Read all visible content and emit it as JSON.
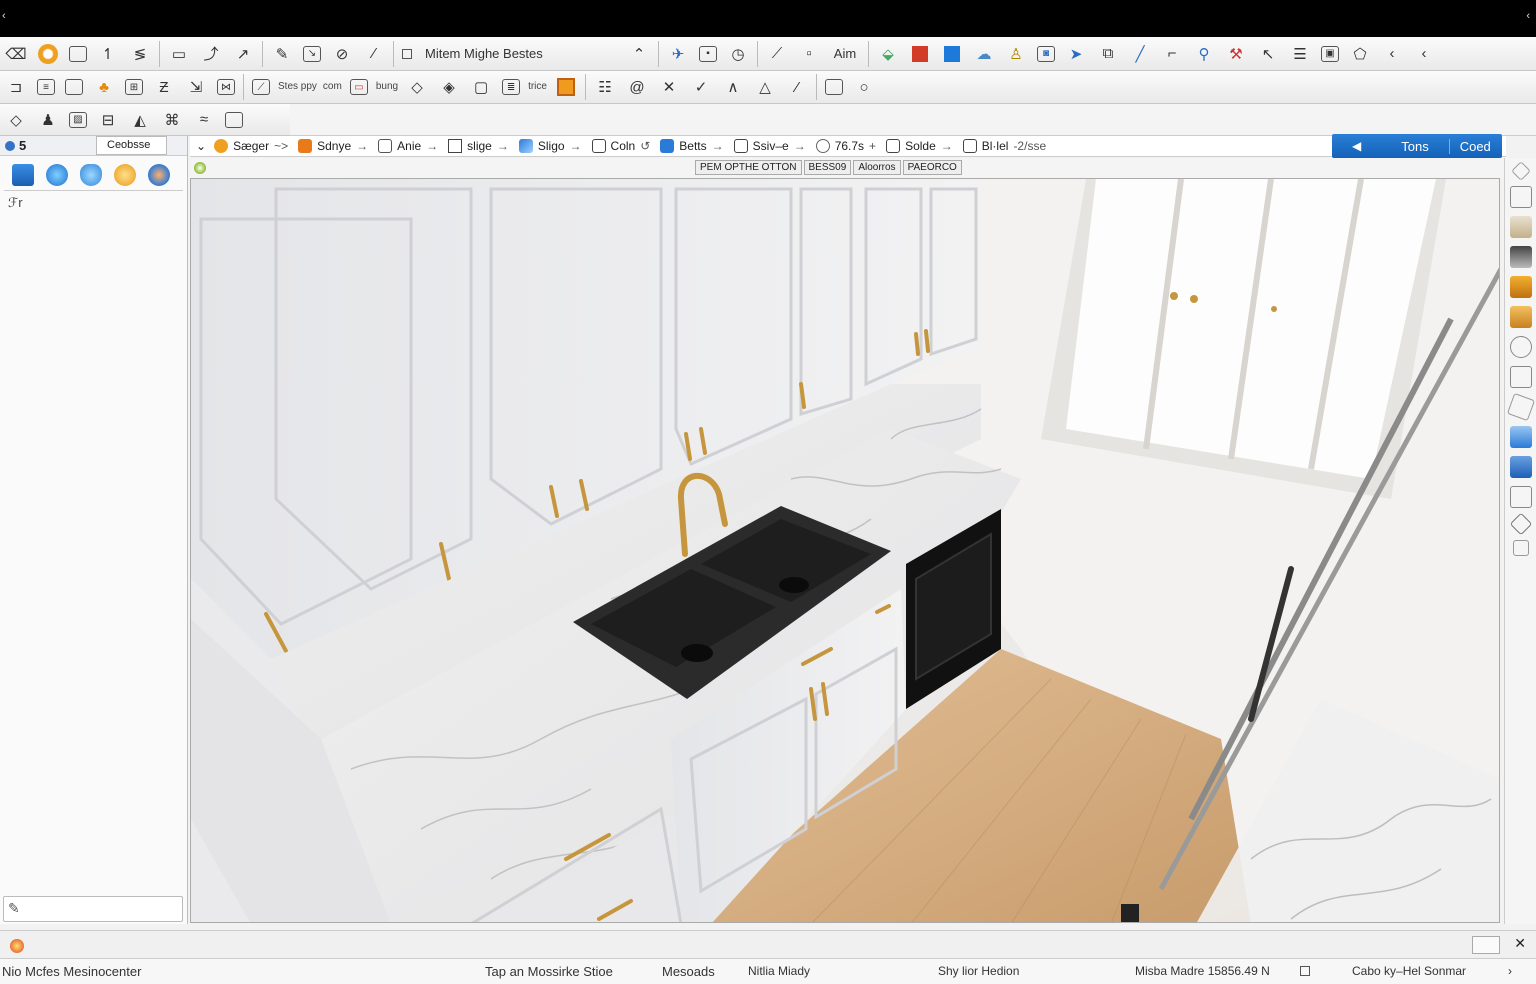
{
  "window": {
    "left_glyph": "‹",
    "right_glyph": "‹"
  },
  "toolbar1": {
    "doc_title": "Mitem Mighe Bestes",
    "text_label": "Aim"
  },
  "toolbar2": {
    "labels": [
      "Stes ppy",
      "com",
      "bung",
      "trice"
    ]
  },
  "sidebar": {
    "number": "5",
    "tab": "Ceobsse",
    "tool_glyph": "ℱr"
  },
  "cmdbar": {
    "items": [
      {
        "label": "Sæger",
        "arrow": "~>"
      },
      {
        "label": "Sdnye",
        "arrow": "→"
      },
      {
        "label": "Anie",
        "arrow": "→"
      },
      {
        "label": "slige",
        "arrow": "→"
      },
      {
        "label": "Sligo",
        "arrow": "→"
      },
      {
        "label": "Coln",
        "arrow": "↺"
      },
      {
        "label": "Betts",
        "arrow": "→"
      },
      {
        "label": "Ssiv–e",
        "arrow": "→"
      },
      {
        "label": "76.7s",
        "arrow": "+"
      },
      {
        "label": "Solde",
        "arrow": "→"
      },
      {
        "label": "Bl·lel",
        "arrow": "-2/sse"
      }
    ],
    "tools_button": "Tons",
    "tools_sub": "Coed"
  },
  "subbar": {
    "tags": [
      "PEM OPTHE OTTON",
      "BESS09",
      "Aloorros",
      "PAEORCO"
    ]
  },
  "status": {
    "left": "Nio Mcfes Mesinocenter",
    "item1": "Tap an Mossirke Stioe",
    "item2": "Mesoads",
    "item3": "Nitlia Miady",
    "item4": "Shy lior Hedion",
    "item5": "Misba Madre 15856.49 N",
    "item6": "Cabo ky–Hel Sonmar"
  },
  "colors": {
    "accent": "#1e6fcc",
    "titlebar": "#000000",
    "cabinet": "#e6e6e8",
    "floor": "#dbb48a",
    "sink": "#2a2a2a",
    "brass": "#c5963e"
  }
}
